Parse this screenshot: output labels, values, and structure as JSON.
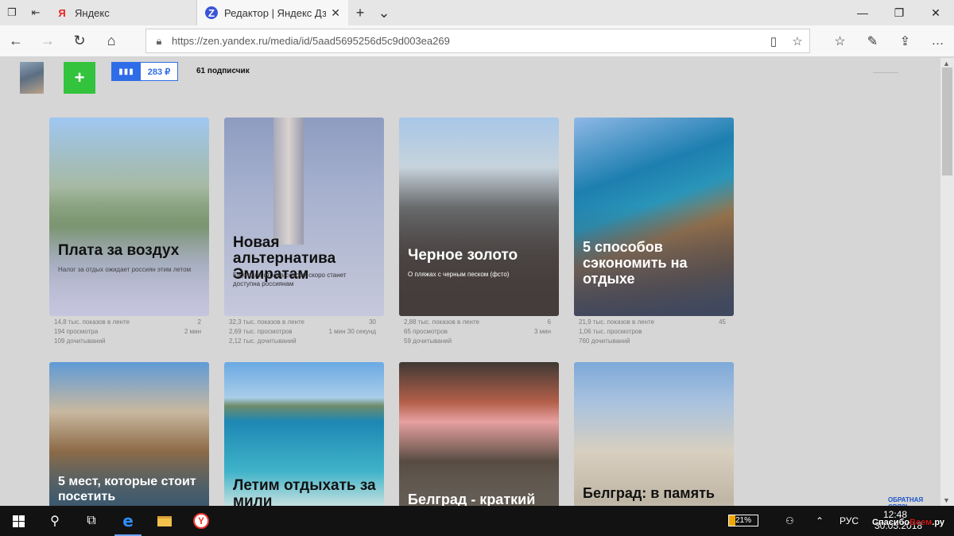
{
  "tabs": [
    {
      "favicon": "yandex-favicon",
      "favicon_text": "Я",
      "title": "Яндекс",
      "active": false
    },
    {
      "favicon": "zen-favicon",
      "favicon_text": "Z",
      "title": "Редактор | Яндекс Дзен",
      "active": true
    }
  ],
  "address_bar": {
    "url": "https://zen.yandex.ru/media/id/5aad5695256d5c9d003ea269"
  },
  "header": {
    "balance": "283 ₽",
    "subscribers": "61 подписчик"
  },
  "cards": [
    {
      "title": "Плата за воздух",
      "desc": "Налог за отдых ожидает россиян этим летом",
      "views": "14,8 тыс. показов в ленте",
      "reads": "194 просмотра",
      "finished": "109 дочитываний",
      "likes": "2",
      "time": "2 мин"
    },
    {
      "title": "Новая альтернатива Эмиратам",
      "desc": "Еще одна страна совсем скоро станет доступна россиянам",
      "views": "32,3 тыс. показов в ленте",
      "reads": "2,69 тыс. просмотров",
      "finished": "2,12 тыс. дочитываний",
      "likes": "30",
      "time": "1 мин 30 секунд"
    },
    {
      "title": "Черное золото",
      "desc": "О пляжах с черным песком (фсто)",
      "views": "2,88 тыс. показов в ленте",
      "reads": "65 просмотров",
      "finished": "59 дочитываний",
      "likes": "6",
      "time": "3 мин"
    },
    {
      "title": "5 способов сэкономить на отдыхе",
      "desc": "",
      "views": "21,9 тыс. показов в ленте",
      "reads": "1,06 тыс. просмотров",
      "finished": "760 дочитываний",
      "likes": "45",
      "time": ""
    },
    {
      "title": "5 мест, которые стоит посетить",
      "desc": ""
    },
    {
      "title": "Летим отдыхать за мили",
      "desc": ""
    },
    {
      "title": "Белград - краткий",
      "desc": ""
    },
    {
      "title": "Белград: в память о прошлом",
      "desc": ""
    }
  ],
  "feedback": "ОБРАТНАЯ СВЯЗЬ",
  "taskbar": {
    "battery": "21%",
    "battery_level": 0.21,
    "language": "РУС",
    "time": "12:48",
    "date": "30.05.2018"
  },
  "watermark": {
    "prefix": "Спасибо",
    "brand": "Всем",
    "suffix": ".ру"
  }
}
